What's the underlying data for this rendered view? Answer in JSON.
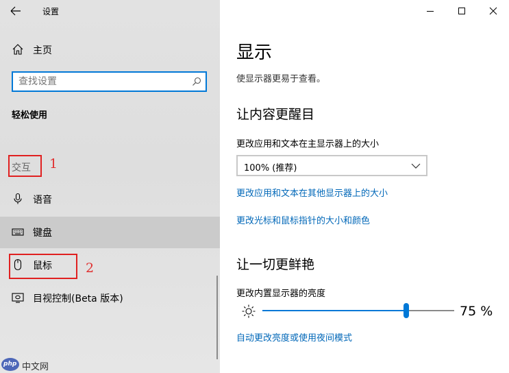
{
  "window": {
    "title": "设置"
  },
  "sidebar": {
    "home_label": "主页",
    "search": {
      "placeholder": "查找设置"
    },
    "section_heading": "轻松使用",
    "category_label": "交互",
    "items": [
      {
        "label": "语音",
        "icon": "microphone-icon"
      },
      {
        "label": "键盘",
        "icon": "keyboard-icon",
        "selected": true
      },
      {
        "label": "鼠标",
        "icon": "mouse-icon"
      },
      {
        "label": "目视控制(Beta 版本)",
        "icon": "eye-control-icon"
      }
    ]
  },
  "annotations": {
    "label_1": "1",
    "label_2": "2",
    "color": "#e02020"
  },
  "watermark": {
    "badge": "php",
    "text": "中文网"
  },
  "main": {
    "title": "显示",
    "subtitle": "使显示器更易于查看。",
    "section1": {
      "heading": "让内容更醒目",
      "scale_label": "更改应用和文本在主显示器上的大小",
      "scale_value": "100% (推荐)",
      "link_other_displays": "更改应用和文本在其他显示器上的大小",
      "link_cursor": "更改光标和鼠标指针的大小和颜色"
    },
    "section2": {
      "heading": "让一切更鲜艳",
      "brightness_label": "更改内置显示器的亮度",
      "brightness_value": 75,
      "brightness_text": "75 %",
      "link_night": "自动更改亮度或使用夜间模式"
    }
  },
  "colors": {
    "accent": "#0078d7",
    "link": "#0067b8",
    "selected_row": "#cbcbcb"
  }
}
